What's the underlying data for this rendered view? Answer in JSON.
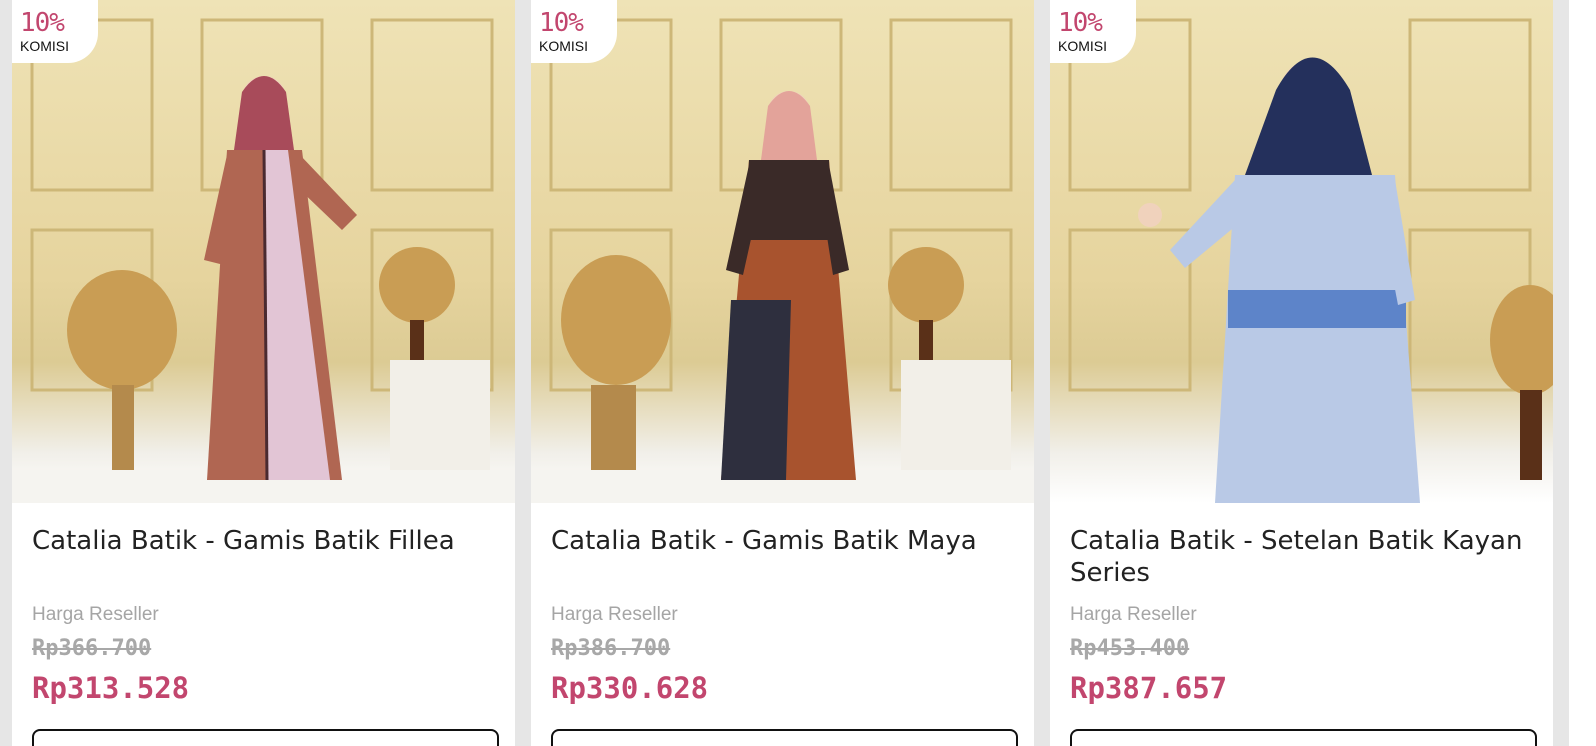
{
  "products": [
    {
      "commission_pct": "10%",
      "commission_label": "KOMISI",
      "title": "Catalia Batik - Gamis Batik Fillea",
      "price_label": "Harga Reseller",
      "original_price": "Rp366.700",
      "reseller_price": "Rp313.528"
    },
    {
      "commission_pct": "10%",
      "commission_label": "KOMISI",
      "title": "Catalia Batik - Gamis Batik Maya",
      "price_label": "Harga Reseller",
      "original_price": "Rp386.700",
      "reseller_price": "Rp330.628"
    },
    {
      "commission_pct": "10%",
      "commission_label": "KOMISI",
      "title": "Catalia Batik - Setelan Batik Kayan Series",
      "price_label": "Harga Reseller",
      "original_price": "Rp453.400",
      "reseller_price": "Rp387.657"
    }
  ],
  "colors": {
    "accent": "#c2466e",
    "muted_text": "#a5a5a5",
    "page_background": "#e6e6e6"
  }
}
